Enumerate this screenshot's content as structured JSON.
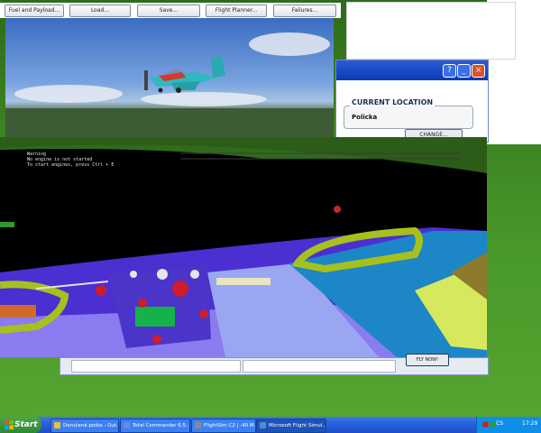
{
  "toolbar": {
    "buttons": [
      "Fuel and Payload...",
      "Load...",
      "Save...",
      "Flight Planner...",
      "Failures..."
    ]
  },
  "setup_dialog": {
    "location_label": "CURRENT LOCATION",
    "location_value": "Policka",
    "change_label": "CHANGE..."
  },
  "message": {
    "lines": [
      "Warning",
      "No engine is not started",
      "To start engines, press Ctrl + E"
    ]
  },
  "dialog": {
    "ok_label": "FLY NOW!"
  },
  "taskbar": {
    "start_label": "Start",
    "tasks": [
      {
        "label": "Doručená pošta - Out...",
        "icon_color": "#f0c030"
      },
      {
        "label": "Total Commander 6.5...",
        "icon_color": "#6a8be0"
      },
      {
        "label": "FlightSim C2 | -40 M...",
        "icon_color": "#8a8a8a"
      },
      {
        "label": "Microsoft Flight Simul...",
        "icon_color": "#4a90d0"
      }
    ],
    "tray": {
      "lang": "CS",
      "clock": "17:29"
    }
  },
  "colors": {
    "taskbar": "#245ddc",
    "start": "#2e8a2e",
    "cockpit_panel": "#4b2fd0",
    "glareshield": "#a8c01c"
  }
}
